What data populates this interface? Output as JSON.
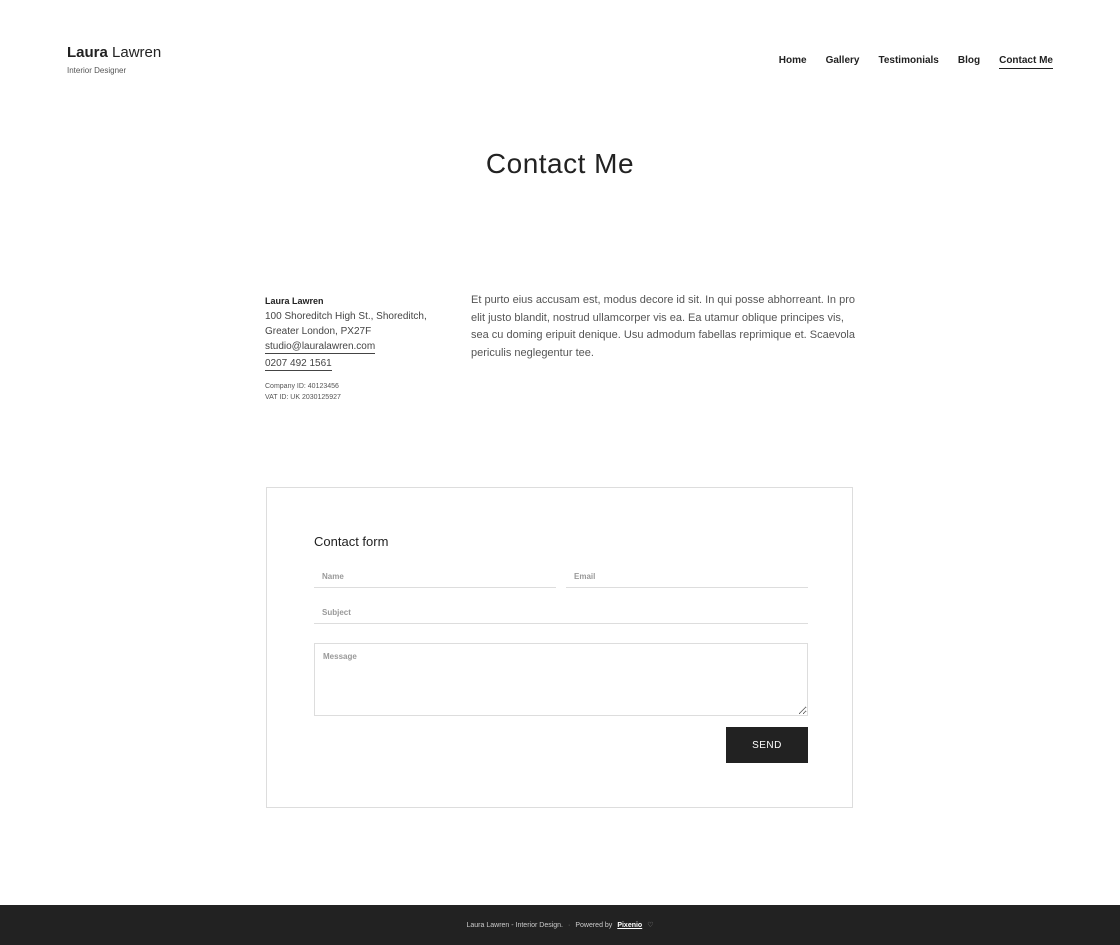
{
  "header": {
    "brand_first": "Laura",
    "brand_last": "Lawren",
    "tagline": "Interior Designer",
    "nav": [
      {
        "label": "Home",
        "active": false
      },
      {
        "label": "Gallery",
        "active": false
      },
      {
        "label": "Testimonials",
        "active": false
      },
      {
        "label": "Blog",
        "active": false
      },
      {
        "label": "Contact Me",
        "active": true
      }
    ]
  },
  "page": {
    "title": "Contact Me"
  },
  "contact": {
    "name": "Laura Lawren",
    "address_line1": "100 Shoreditch High St., Shoreditch,",
    "address_line2": "Greater London, PX27F",
    "email": "studio@lauralawren.com",
    "phone": "0207 492 1561",
    "company_id": "Company ID: 40123456",
    "vat_id": "VAT ID: UK 2030125927"
  },
  "about": {
    "text": "Et purto eius accusam est, modus decore id sit. In qui posse abhorreant. In pro elit justo blandit, nostrud ullamcorper vis ea. Ea utamur oblique principes vis, sea cu doming eripuit denique. Usu admodum fabellas reprimique et. Scaevola periculis neglegentur tee."
  },
  "form": {
    "title": "Contact form",
    "name_placeholder": "Name",
    "email_placeholder": "Email",
    "subject_placeholder": "Subject",
    "message_placeholder": "Message",
    "send_label": "SEND"
  },
  "footer": {
    "credit": "Laura Lawren - Interior Design.",
    "separator": "·",
    "powered_by": "Powered by",
    "powered_link": "Pixenio",
    "heart": "♡"
  },
  "colors": {
    "text": "#222222",
    "footer_bg": "#222222",
    "button_bg": "#222222",
    "border": "#dddddd"
  }
}
